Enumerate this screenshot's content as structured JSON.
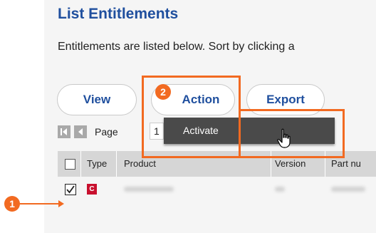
{
  "page": {
    "title": "List Entitlements",
    "description": "Entitlements are listed below. Sort by clicking a"
  },
  "toolbar": {
    "view_label": "View",
    "action_label": "Action",
    "export_label": "Export"
  },
  "pager": {
    "label": "Page",
    "current": "1",
    "icons": [
      "first-page-icon",
      "prev-page-icon"
    ]
  },
  "table": {
    "columns": [
      "Type",
      "Product",
      "Version",
      "Part nu"
    ],
    "rows": [
      {
        "checked": true,
        "type_icon": "C"
      }
    ]
  },
  "dropdown": {
    "items": [
      "Activate"
    ]
  },
  "annotations": {
    "step1": "1",
    "step2": "2"
  },
  "colors": {
    "accent": "#f26a21",
    "title": "#1f4f9e",
    "menu_bg": "#4a4a4a",
    "type_icon": "#c8102e"
  }
}
